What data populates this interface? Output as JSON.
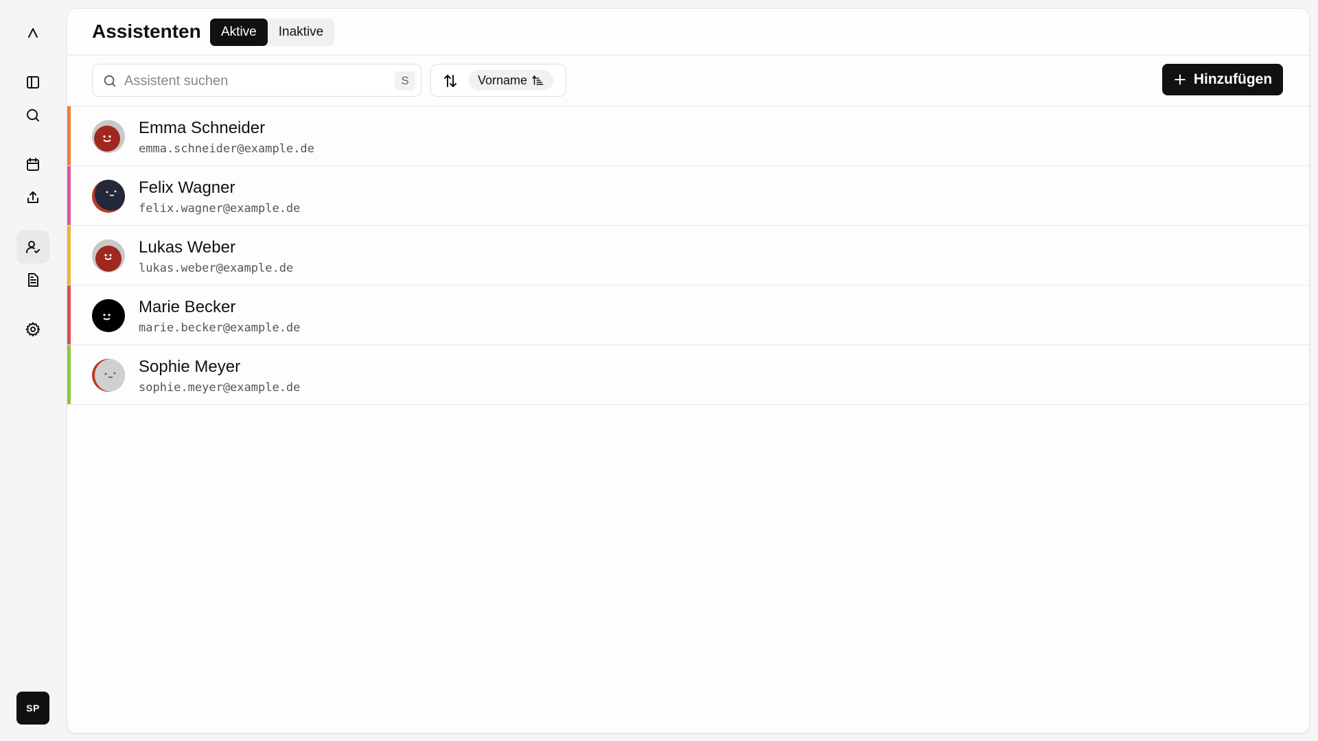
{
  "header": {
    "title": "Assistenten",
    "tabs": [
      {
        "label": "Aktive",
        "active": true
      },
      {
        "label": "Inaktive",
        "active": false
      }
    ]
  },
  "toolbar": {
    "search_placeholder": "Assistent suchen",
    "search_shortcut": "S",
    "sort_label": "Vorname",
    "add_label": "Hinzufügen"
  },
  "user": {
    "initials": "SP"
  },
  "sidebar": {
    "items": [
      {
        "icon": "logo-icon"
      },
      {
        "icon": "panel-toggle-icon"
      },
      {
        "icon": "search-icon"
      },
      {
        "icon": "calendar-icon"
      },
      {
        "icon": "share-icon"
      },
      {
        "icon": "user-check-icon",
        "active": true
      },
      {
        "icon": "document-icon"
      },
      {
        "icon": "gear-icon"
      }
    ]
  },
  "assistants": [
    {
      "name": "Emma Schneider",
      "email": "emma.schneider@example.de",
      "accent": "#e8803a",
      "avatar_bg": "#c9c9c9",
      "avatar_fg": "#a0281e"
    },
    {
      "name": "Felix Wagner",
      "email": "felix.wagner@example.de",
      "accent": "#d65a9e",
      "avatar_bg": "#b83a26",
      "avatar_fg": "#23283a"
    },
    {
      "name": "Lukas Weber",
      "email": "lukas.weber@example.de",
      "accent": "#e6b93a",
      "avatar_bg": "#c9c9c9",
      "avatar_fg": "#a0281e"
    },
    {
      "name": "Marie Becker",
      "email": "marie.becker@example.de",
      "accent": "#d6505a",
      "avatar_bg": "#000000",
      "avatar_fg": "#000000"
    },
    {
      "name": "Sophie Meyer",
      "email": "sophie.meyer@example.de",
      "accent": "#8cc63f",
      "avatar_bg": "#b83a26",
      "avatar_fg": "#d0d0d0"
    }
  ]
}
